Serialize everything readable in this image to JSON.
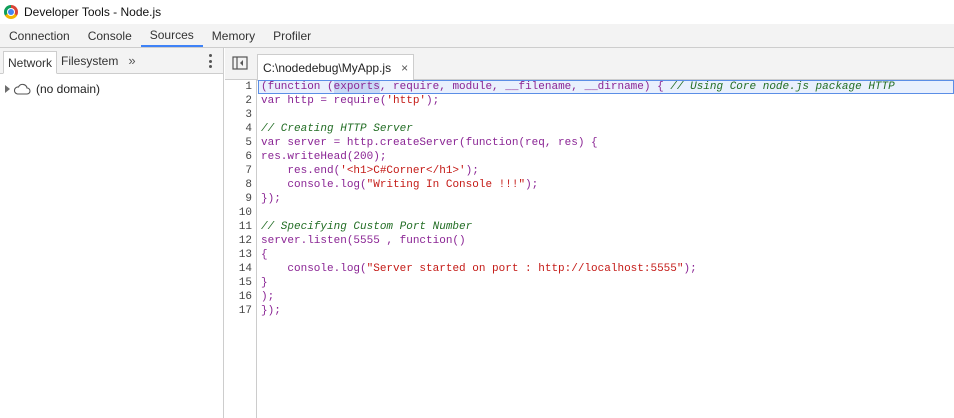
{
  "window": {
    "title": "Developer Tools - Node.js"
  },
  "main_tabs": [
    {
      "label": "Connection"
    },
    {
      "label": "Console"
    },
    {
      "label": "Sources",
      "active": true
    },
    {
      "label": "Memory"
    },
    {
      "label": "Profiler"
    }
  ],
  "navigator": {
    "tabs": [
      {
        "label": "Network",
        "active": true
      },
      {
        "label": "Filesystem"
      }
    ],
    "more_label": "»",
    "tree": [
      {
        "label": "(no domain)",
        "icon": "cloud-icon"
      }
    ]
  },
  "editor": {
    "file_tab": "C:\\nodedebug\\MyApp.js",
    "close_label": "×",
    "line_numbers": [
      "1",
      "2",
      "3",
      "4",
      "5",
      "6",
      "7",
      "8",
      "9",
      "10",
      "11",
      "12",
      "13",
      "14",
      "15",
      "16",
      "17"
    ],
    "current_line": 1,
    "code": {
      "l1a": "(function (",
      "l1b": "exports",
      "l1c": ", require, module, __filename, __dirname) { ",
      "l1d": "// Using Core node.js package HTTP",
      "l2a": "var http = require(",
      "l2b": "'http'",
      "l2c": ");",
      "l3": "",
      "l4": "// Creating HTTP Server",
      "l5": "var server = http.createServer(function(req, res) {",
      "l6": "res.writeHead(200);",
      "l7a": "    res.end(",
      "l7b": "'<h1>C#Corner</h1>'",
      "l7c": ");",
      "l8a": "    console.log(",
      "l8b": "\"Writing In Console !!!\"",
      "l8c": ");",
      "l9": "});",
      "l10": "",
      "l11": "// Specifying Custom Port Number",
      "l12": "server.listen(5555 , function()",
      "l13": "{",
      "l14a": "    console.log(",
      "l14b": "\"Server started on port : http://localhost:5555\"",
      "l14c": ");",
      "l15": "}",
      "l16": ");",
      "l17": "});"
    }
  },
  "colors": {
    "accent": "#3e82f7",
    "keyword": "#8a2494",
    "string": "#c41a16",
    "comment": "#236e25",
    "current_line": "#e9f0fd"
  }
}
